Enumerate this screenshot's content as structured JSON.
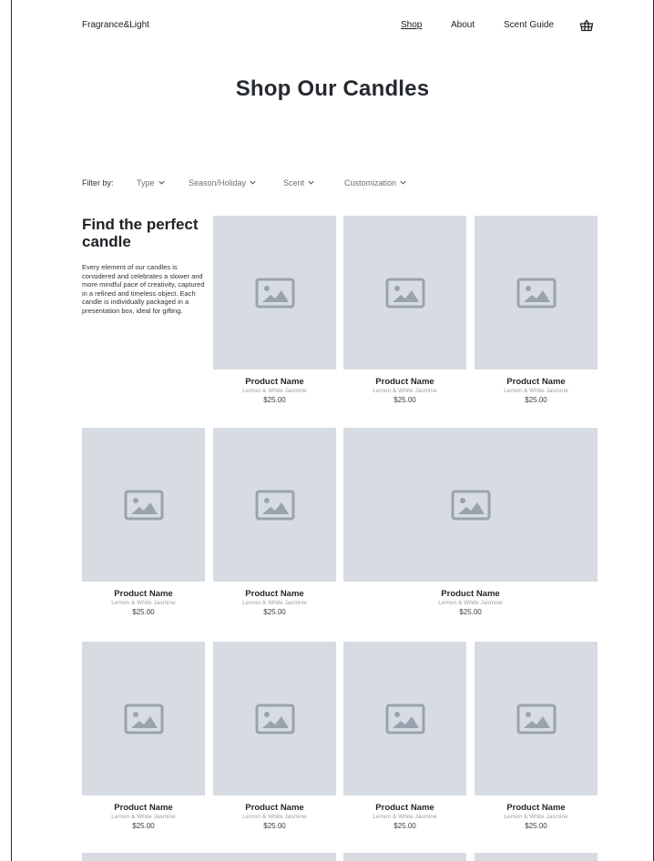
{
  "header": {
    "brand": "Fragrance&Light",
    "nav": {
      "shop": "Shop",
      "about": "About",
      "scent_guide": "Scent Guide"
    },
    "cart_icon": "basket-icon"
  },
  "page": {
    "title": "Shop Our Candles"
  },
  "filters": {
    "label": "Filter by:",
    "type": "Type",
    "season": "Season/Holiday",
    "scent": "Scent",
    "customization": "Customization"
  },
  "intro": {
    "title": "Find the perfect candle",
    "text": "Every element of our candles is considered and celebrates a slower and more mindful pace of creativity, captured in a refined and timeless object. Each candle is individually packaged in a presentation box, ideal for gifting."
  },
  "products": [
    {
      "name": "Product Name",
      "scent": "Lemon & White Jasmine",
      "price": "$25.00"
    },
    {
      "name": "Product Name",
      "scent": "Lemon & White Jasmine",
      "price": "$25.00"
    },
    {
      "name": "Product Name",
      "scent": "Lemon & White Jasmine",
      "price": "$25.00"
    },
    {
      "name": "Product Name",
      "scent": "Lemon & White Jasmine",
      "price": "$25.00"
    },
    {
      "name": "Product Name",
      "scent": "Lemon & White Jasmine",
      "price": "$25.00"
    },
    {
      "name": "Product Name",
      "scent": "Lemon & White Jasmine",
      "price": "$25.00"
    },
    {
      "name": "Product Name",
      "scent": "Lemon & White Jasmine",
      "price": "$25.00"
    },
    {
      "name": "Product Name",
      "scent": "Lemon & White Jasmine",
      "price": "$25.00"
    },
    {
      "name": "Product Name",
      "scent": "Lemon & White Jasmine",
      "price": "$25.00"
    },
    {
      "name": "Product Name",
      "scent": "Lemon & White Jasmine",
      "price": "$25.00"
    }
  ],
  "colors": {
    "placeholder_bg": "#d7dce2",
    "placeholder_icon": "#9aa3ad",
    "text_dark": "#1f2226",
    "text_muted": "#9aa0a8"
  }
}
